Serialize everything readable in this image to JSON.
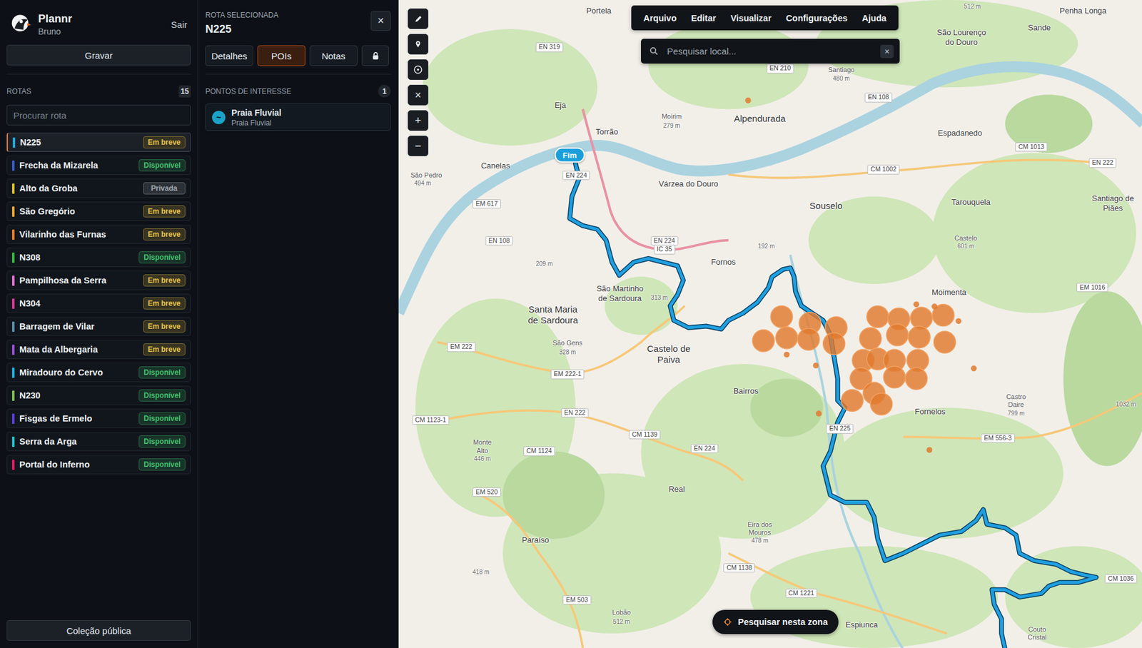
{
  "app": {
    "name": "Plannr",
    "user": "Bruno",
    "logout": "Sair"
  },
  "record_button": "Gravar",
  "routes_header": {
    "title": "ROTAS",
    "count": "15"
  },
  "route_search": {
    "placeholder": "Procurar rota"
  },
  "routes": [
    {
      "name": "N225",
      "color": "#1fa8e0",
      "selected": true,
      "badge": {
        "label": "Em breve",
        "color": "#e3c24d"
      }
    },
    {
      "name": "Frecha da Mizarela",
      "color": "#3b5bd1",
      "selected": false,
      "badge": {
        "label": "Disponível",
        "color": "#45c070"
      }
    },
    {
      "name": "Alto da Groba",
      "color": "#e2c21a",
      "selected": false,
      "badge": {
        "label": "Privada",
        "color": "#a4aab2"
      }
    },
    {
      "name": "São Gregório",
      "color": "#f2a81d",
      "selected": false,
      "badge": {
        "label": "Em breve",
        "color": "#e3c24d"
      }
    },
    {
      "name": "Vilarinho das Furnas",
      "color": "#f07f1a",
      "selected": false,
      "badge": {
        "label": "Em breve",
        "color": "#e3c24d"
      }
    },
    {
      "name": "N308",
      "color": "#2fbf3a",
      "selected": false,
      "badge": {
        "label": "Disponível",
        "color": "#45c070"
      }
    },
    {
      "name": "Pampilhosa da Serra",
      "color": "#e86fd6",
      "selected": false,
      "badge": {
        "label": "Em breve",
        "color": "#e3c24d"
      }
    },
    {
      "name": "N304",
      "color": "#e0349a",
      "selected": false,
      "badge": {
        "label": "Em breve",
        "color": "#e3c24d"
      }
    },
    {
      "name": "Barragem de Vilar",
      "color": "#5a8fa8",
      "selected": false,
      "badge": {
        "label": "Em breve",
        "color": "#e3c24d"
      }
    },
    {
      "name": "Mata da Albergaria",
      "color": "#9b4fd9",
      "selected": false,
      "badge": {
        "label": "Em breve",
        "color": "#e3c24d"
      }
    },
    {
      "name": "Miradouro do Cervo",
      "color": "#14b6e8",
      "selected": false,
      "badge": {
        "label": "Disponível",
        "color": "#45c070"
      }
    },
    {
      "name": "N230",
      "color": "#7dc24a",
      "selected": false,
      "badge": {
        "label": "Disponível",
        "color": "#45c070"
      }
    },
    {
      "name": "Fisgas de Ermelo",
      "color": "#5b3fe0",
      "selected": false,
      "badge": {
        "label": "Disponível",
        "color": "#45c070"
      }
    },
    {
      "name": "Serra da Arga",
      "color": "#19c7d6",
      "selected": false,
      "badge": {
        "label": "Disponível",
        "color": "#45c070"
      }
    },
    {
      "name": "Portal do Inferno",
      "color": "#e8196b",
      "selected": false,
      "badge": {
        "label": "Disponível",
        "color": "#45c070"
      }
    }
  ],
  "public_collection_button": "Coleção pública",
  "panel": {
    "caption": "ROTA SELECIONADA",
    "title": "N225",
    "close": "×",
    "tabs": [
      {
        "label": "Detalhes",
        "selected": false
      },
      {
        "label": "POIs",
        "selected": true
      },
      {
        "label": "Notas",
        "selected": false
      }
    ],
    "lock_tab": {
      "selected": false
    },
    "poi_section": {
      "title": "PONTOS DE INTERESSE",
      "count": "1"
    },
    "pois": [
      {
        "icon": "~",
        "title": "Praia Fluvial",
        "subtitle": "Praia Fluvial"
      }
    ]
  },
  "map": {
    "menu": [
      "Arquivo",
      "Editar",
      "Visualizar",
      "Configurações",
      "Ajuda"
    ],
    "search": {
      "placeholder": "Pesquisar local...",
      "clear": "×"
    },
    "tools": [
      "×",
      "+",
      "−"
    ],
    "route_end_label": "Fim",
    "search_area_button": "Pesquisar nesta zona",
    "labels": [
      {
        "text": "Portela",
        "kind": "place"
      },
      {
        "text": "EN 319",
        "kind": "road"
      },
      {
        "text": "512 m",
        "kind": "height"
      },
      {
        "text": "Penha Longa",
        "kind": "place"
      },
      {
        "text": "Sande",
        "kind": "place"
      },
      {
        "text": "São Lourenço",
        "kind": "place"
      },
      {
        "text": "do Douro",
        "kind": "place"
      },
      {
        "text": "EN 210",
        "kind": "road"
      },
      {
        "text": "Santiago",
        "kind": "small"
      },
      {
        "text": "480 m",
        "kind": "height"
      },
      {
        "text": "EN 108",
        "kind": "road"
      },
      {
        "text": "Eja",
        "kind": "place"
      },
      {
        "text": "Moirim",
        "kind": "small"
      },
      {
        "text": "279 m",
        "kind": "height"
      },
      {
        "text": "Alpendurada",
        "kind": "big"
      },
      {
        "text": "Torrão",
        "kind": "place"
      },
      {
        "text": "Espadanedo",
        "kind": "place"
      },
      {
        "text": "CM 1013",
        "kind": "road"
      },
      {
        "text": "EN 222",
        "kind": "road"
      },
      {
        "text": "CM 1002",
        "kind": "road"
      },
      {
        "text": "Canelas",
        "kind": "place"
      },
      {
        "text": "São Pedro",
        "kind": "small"
      },
      {
        "text": "494 m",
        "kind": "height"
      },
      {
        "text": "EN 224",
        "kind": "road"
      },
      {
        "text": "Várzea do Douro",
        "kind": "place"
      },
      {
        "text": "Souselo",
        "kind": "big"
      },
      {
        "text": "Tarouquela",
        "kind": "place"
      },
      {
        "text": "Santiago de",
        "kind": "place"
      },
      {
        "text": "Piães",
        "kind": "place"
      },
      {
        "text": "EM 617",
        "kind": "road"
      },
      {
        "text": "EN 108",
        "kind": "road"
      },
      {
        "text": "EN 224",
        "kind": "road"
      },
      {
        "text": "IC 35",
        "kind": "road"
      },
      {
        "text": "Castelo",
        "kind": "small"
      },
      {
        "text": "601 m",
        "kind": "height"
      },
      {
        "text": "192 m",
        "kind": "height"
      },
      {
        "text": "Fornos",
        "kind": "place"
      },
      {
        "text": "209 m",
        "kind": "height"
      },
      {
        "text": "São Martinho",
        "kind": "place"
      },
      {
        "text": "de Sardoura",
        "kind": "place"
      },
      {
        "text": "313 m",
        "kind": "height"
      },
      {
        "text": "Moimenta",
        "kind": "place"
      },
      {
        "text": "EM 1016",
        "kind": "road"
      },
      {
        "text": "Santa Maria",
        "kind": "big"
      },
      {
        "text": "de Sardoura",
        "kind": "big"
      },
      {
        "text": "São Gens",
        "kind": "small"
      },
      {
        "text": "328 m",
        "kind": "height"
      },
      {
        "text": "EM 222",
        "kind": "road"
      },
      {
        "text": "Castelo de",
        "kind": "big"
      },
      {
        "text": "Paiva",
        "kind": "big"
      },
      {
        "text": "EM 222-1",
        "kind": "road"
      },
      {
        "text": "Bairros",
        "kind": "place"
      },
      {
        "text": "Castro",
        "kind": "small"
      },
      {
        "text": "Daire",
        "kind": "small"
      },
      {
        "text": "799 m",
        "kind": "height"
      },
      {
        "text": "Fornelos",
        "kind": "place"
      },
      {
        "text": "1032 m",
        "kind": "height"
      },
      {
        "text": "EN 222",
        "kind": "road"
      },
      {
        "text": "CM 1123-1",
        "kind": "road"
      },
      {
        "text": "EN 225",
        "kind": "road"
      },
      {
        "text": "CM 1139",
        "kind": "road"
      },
      {
        "text": "EM 556-3",
        "kind": "road"
      },
      {
        "text": "Monte",
        "kind": "small"
      },
      {
        "text": "Alto",
        "kind": "small"
      },
      {
        "text": "446 m",
        "kind": "height"
      },
      {
        "text": "CM 1124",
        "kind": "road"
      },
      {
        "text": "EN 224",
        "kind": "road"
      },
      {
        "text": "EM 520",
        "kind": "road"
      },
      {
        "text": "Real",
        "kind": "place"
      },
      {
        "text": "Eira dos",
        "kind": "small"
      },
      {
        "text": "Mouros",
        "kind": "small"
      },
      {
        "text": "478 m",
        "kind": "height"
      },
      {
        "text": "Paraíso",
        "kind": "place"
      },
      {
        "text": "418 m",
        "kind": "height"
      },
      {
        "text": "CM 1138",
        "kind": "road"
      },
      {
        "text": "CM 1221",
        "kind": "road"
      },
      {
        "text": "EM 503",
        "kind": "road"
      },
      {
        "text": "Lobão",
        "kind": "small"
      },
      {
        "text": "512 m",
        "kind": "height"
      },
      {
        "text": "Espiunca",
        "kind": "place"
      },
      {
        "text": "CM 1036",
        "kind": "road"
      },
      {
        "text": "Couto",
        "kind": "small"
      },
      {
        "text": "Cristal",
        "kind": "small"
      }
    ]
  }
}
